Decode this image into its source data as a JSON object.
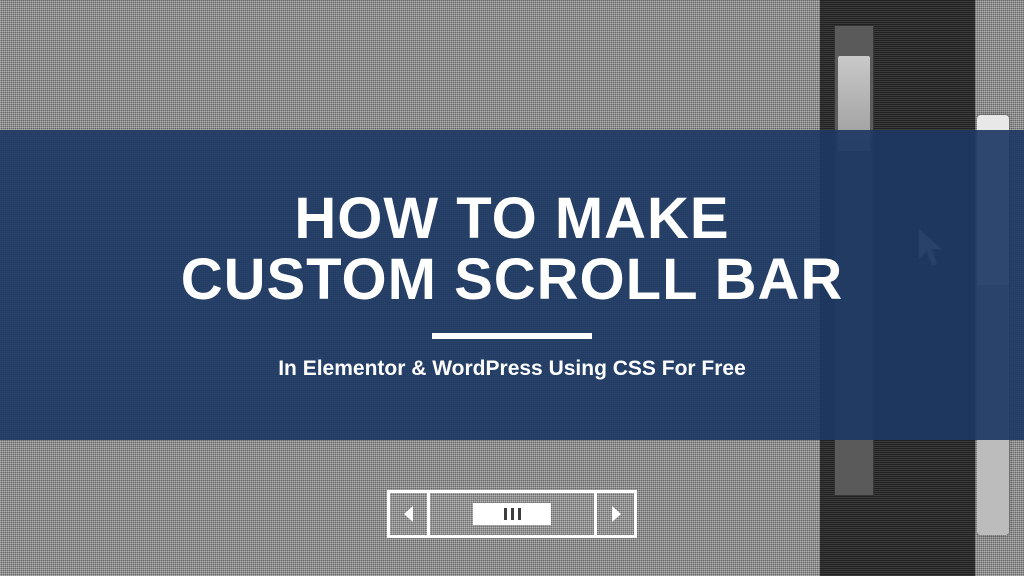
{
  "banner": {
    "title": "HOW TO MAKE\nCUSTOM SCROLL BAR",
    "subtitle": "In Elementor & WordPress Using CSS For Free"
  },
  "colors": {
    "banner_bg": "#1c3864",
    "text": "#ffffff"
  }
}
